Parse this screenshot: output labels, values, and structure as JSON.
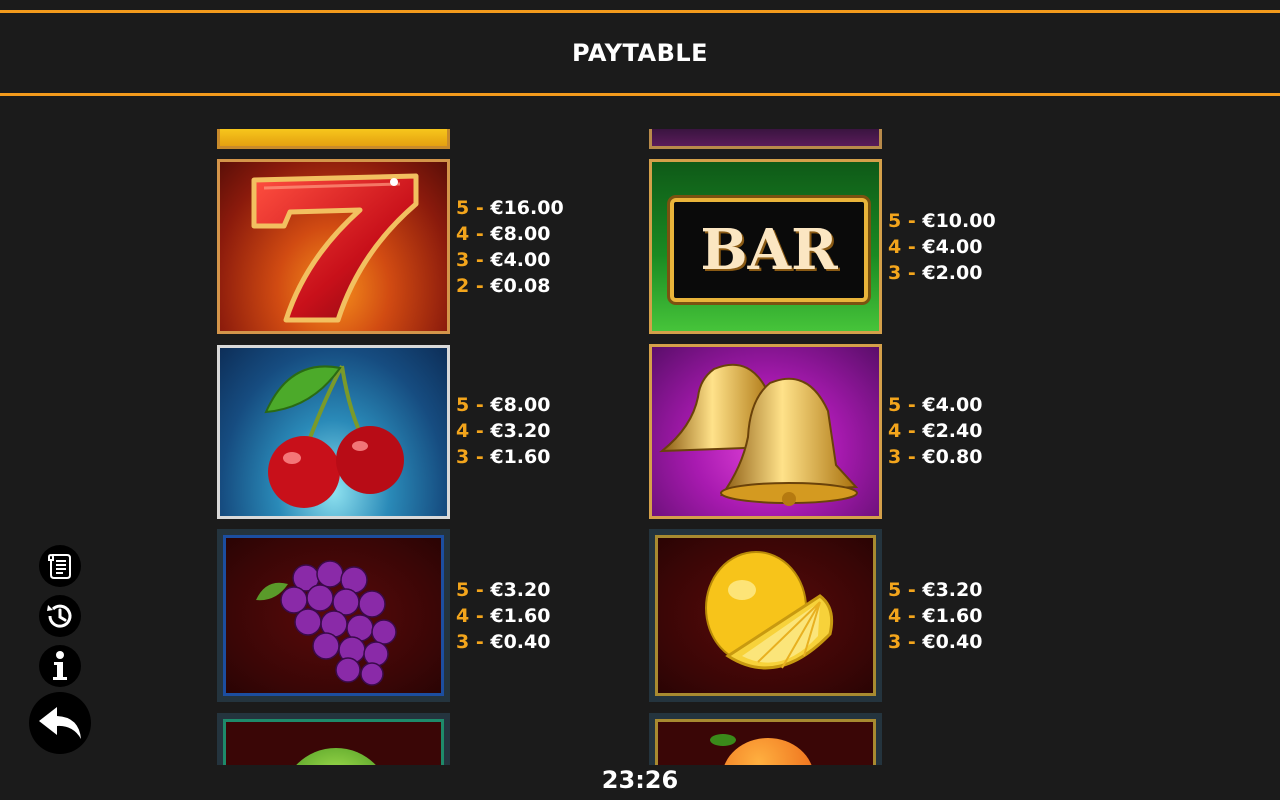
{
  "header": {
    "title": "PAYTABLE"
  },
  "paytable": {
    "seven": {
      "pays": [
        {
          "count": "5 -",
          "amount": "€16.00"
        },
        {
          "count": "4 -",
          "amount": "€8.00"
        },
        {
          "count": "3 -",
          "amount": "€4.00"
        },
        {
          "count": "2 -",
          "amount": "€0.08"
        }
      ]
    },
    "bar": {
      "label": "BAR",
      "pays": [
        {
          "count": "5 -",
          "amount": "€10.00"
        },
        {
          "count": "4 -",
          "amount": "€4.00"
        },
        {
          "count": "3 -",
          "amount": "€2.00"
        }
      ]
    },
    "cherry": {
      "pays": [
        {
          "count": "5 -",
          "amount": "€8.00"
        },
        {
          "count": "4 -",
          "amount": "€3.20"
        },
        {
          "count": "3 -",
          "amount": "€1.60"
        }
      ]
    },
    "bell": {
      "pays": [
        {
          "count": "5 -",
          "amount": "€4.00"
        },
        {
          "count": "4 -",
          "amount": "€2.40"
        },
        {
          "count": "3 -",
          "amount": "€0.80"
        }
      ]
    },
    "grape": {
      "pays": [
        {
          "count": "5 -",
          "amount": "€3.20"
        },
        {
          "count": "4 -",
          "amount": "€1.60"
        },
        {
          "count": "3 -",
          "amount": "€0.40"
        }
      ]
    },
    "lemon": {
      "pays": [
        {
          "count": "5 -",
          "amount": "€3.20"
        },
        {
          "count": "4 -",
          "amount": "€1.60"
        },
        {
          "count": "3 -",
          "amount": "€0.40"
        }
      ]
    }
  },
  "sidebar": {
    "icons": [
      "rules-icon",
      "history-icon",
      "info-icon",
      "back-arrow-icon"
    ]
  },
  "status": {
    "clock": "23:26"
  },
  "colors": {
    "accent": "#f39a1c",
    "count": "#f3a51c",
    "background": "#1b1b1b"
  }
}
